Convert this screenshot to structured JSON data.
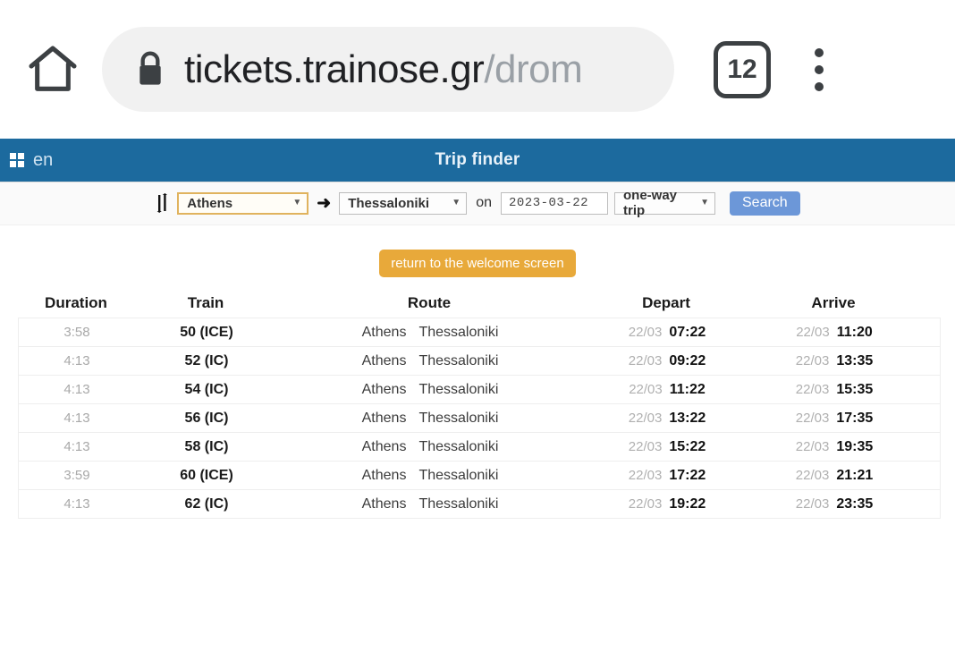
{
  "browser": {
    "home_icon": "home-icon",
    "lock_icon": "lock-icon",
    "url_domain": "tickets.trainose.gr",
    "url_path": "/drom",
    "tab_count": "12",
    "menu_icon": "overflow-menu-icon"
  },
  "app_header": {
    "grid_icon": "grid-apps-icon",
    "language": "en",
    "title": "Trip finder"
  },
  "search": {
    "swap_icon": "swap-vertical-icon",
    "origin": "Athens",
    "arrow_icon": "arrow-right-icon",
    "destination": "Thessaloniki",
    "on_label": "on",
    "date": "2023-03-22",
    "trip_type": "one-way trip",
    "search_label": "Search",
    "caret_glyph": "▼"
  },
  "return_button": {
    "label": "return to the welcome screen"
  },
  "results": {
    "columns": [
      "Duration",
      "Train",
      "Route",
      "Depart",
      "Arrive"
    ],
    "rows": [
      {
        "duration": "3:58",
        "train": "50 (ICE)",
        "from": "Athens",
        "to": "Thessaloniki",
        "depart_date": "22/03",
        "depart_time": "07:22",
        "arrive_date": "22/03",
        "arrive_time": "11:20"
      },
      {
        "duration": "4:13",
        "train": "52 (IC)",
        "from": "Athens",
        "to": "Thessaloniki",
        "depart_date": "22/03",
        "depart_time": "09:22",
        "arrive_date": "22/03",
        "arrive_time": "13:35"
      },
      {
        "duration": "4:13",
        "train": "54 (IC)",
        "from": "Athens",
        "to": "Thessaloniki",
        "depart_date": "22/03",
        "depart_time": "11:22",
        "arrive_date": "22/03",
        "arrive_time": "15:35"
      },
      {
        "duration": "4:13",
        "train": "56 (IC)",
        "from": "Athens",
        "to": "Thessaloniki",
        "depart_date": "22/03",
        "depart_time": "13:22",
        "arrive_date": "22/03",
        "arrive_time": "17:35"
      },
      {
        "duration": "4:13",
        "train": "58 (IC)",
        "from": "Athens",
        "to": "Thessaloniki",
        "depart_date": "22/03",
        "depart_time": "15:22",
        "arrive_date": "22/03",
        "arrive_time": "19:35"
      },
      {
        "duration": "3:59",
        "train": "60 (ICE)",
        "from": "Athens",
        "to": "Thessaloniki",
        "depart_date": "22/03",
        "depart_time": "17:22",
        "arrive_date": "22/03",
        "arrive_time": "21:21"
      },
      {
        "duration": "4:13",
        "train": "62 (IC)",
        "from": "Athens",
        "to": "Thessaloniki",
        "depart_date": "22/03",
        "depart_time": "19:22",
        "arrive_date": "22/03",
        "arrive_time": "23:35"
      }
    ]
  },
  "colors": {
    "header_blue": "#1c6a9e",
    "search_button": "#6c97d8",
    "return_button": "#e8a93a",
    "focus_border": "#e0b35e"
  }
}
